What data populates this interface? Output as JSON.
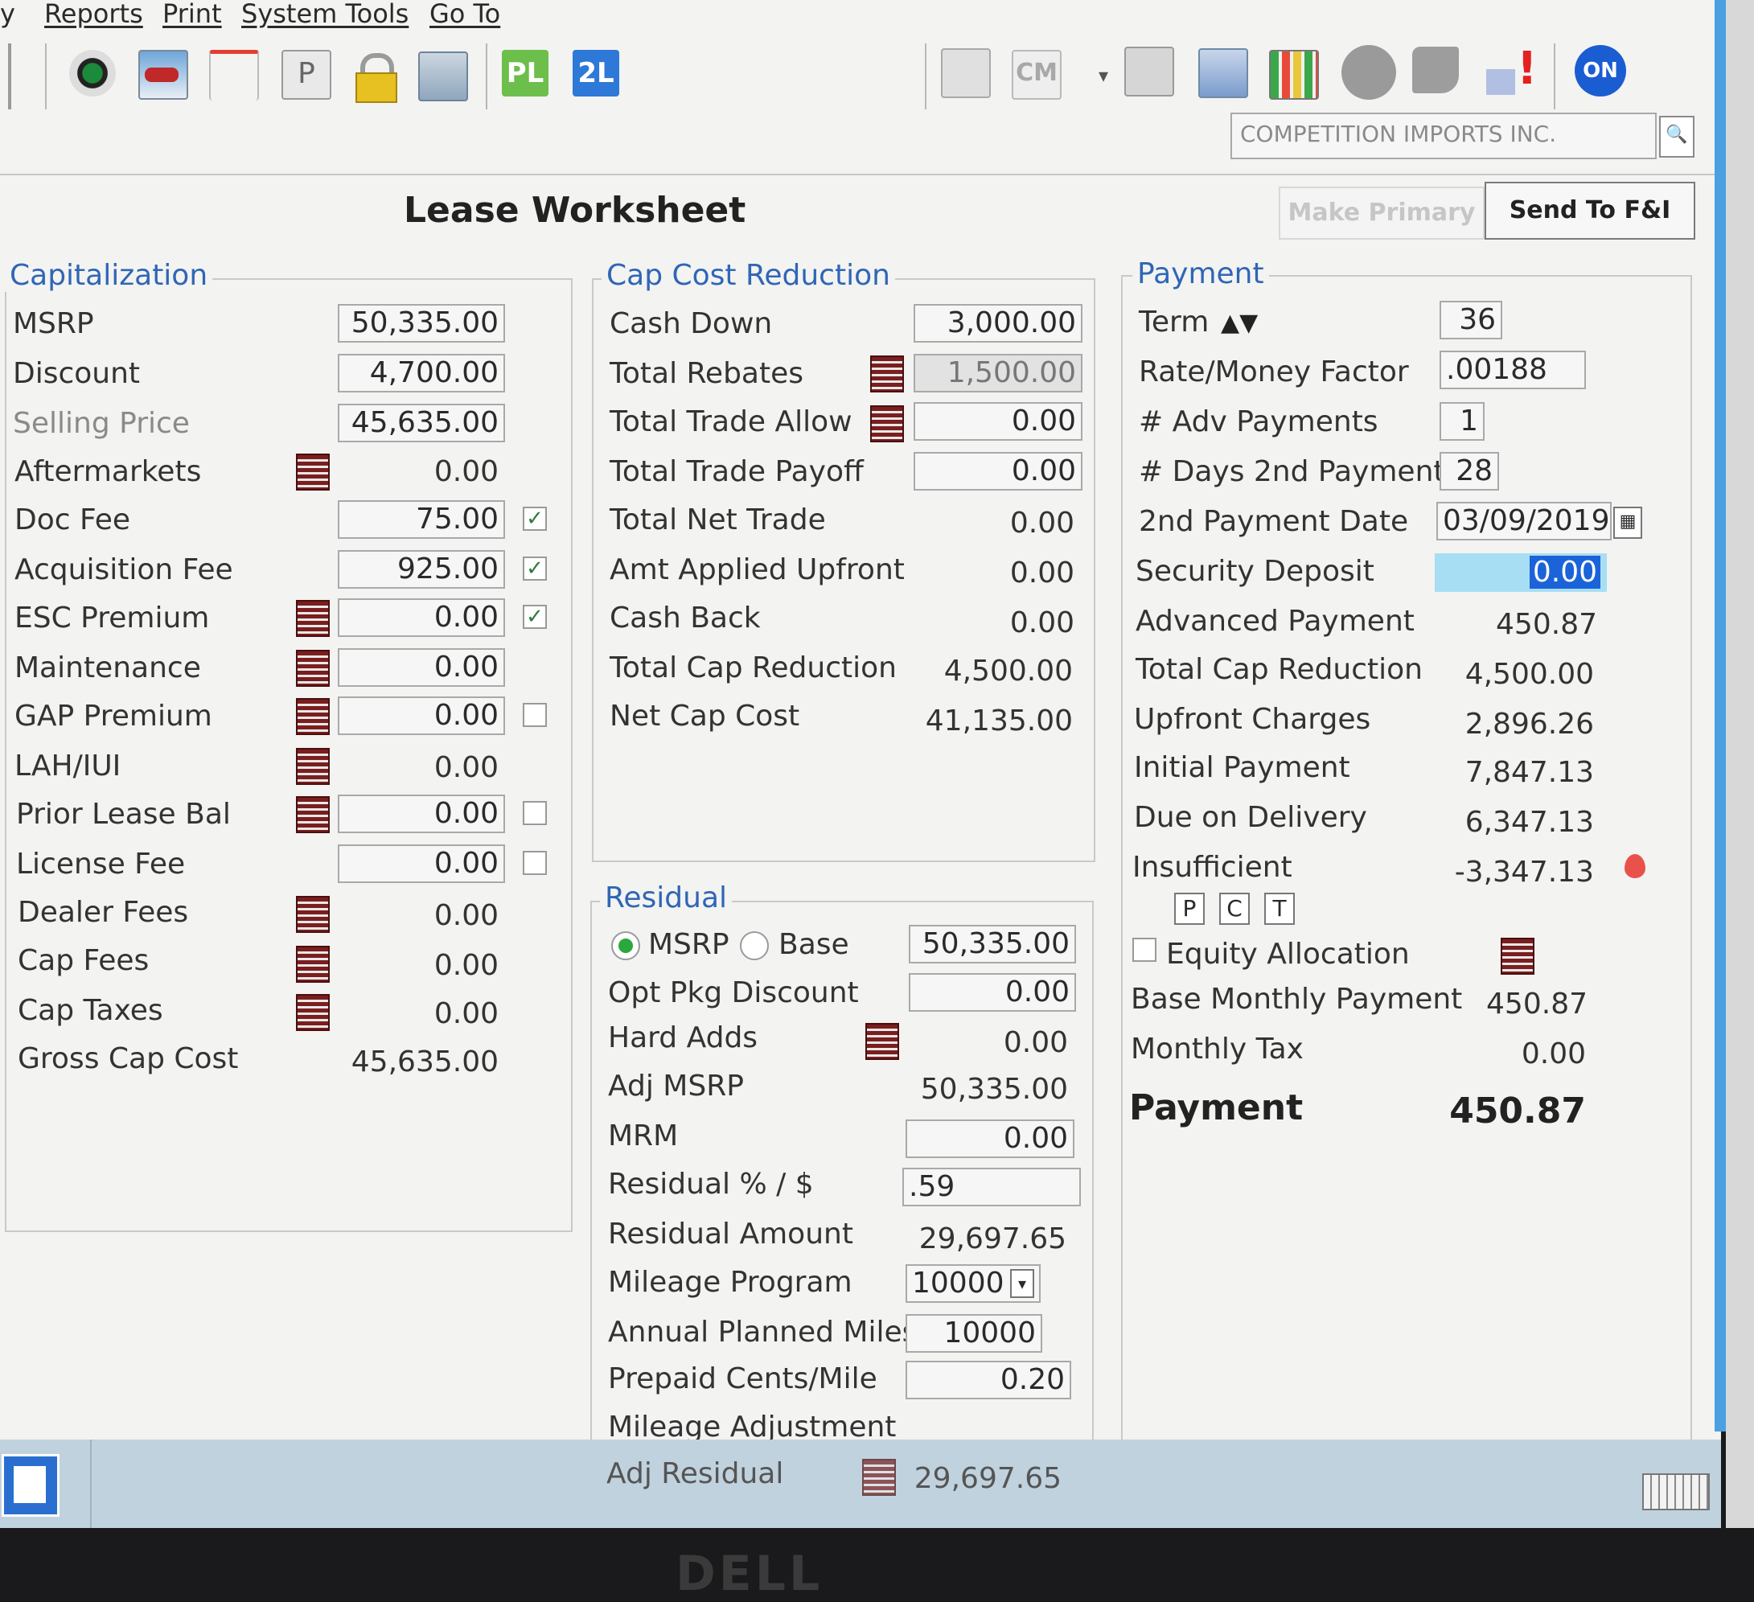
{
  "menu": {
    "item_y": "y",
    "reports": "Reports",
    "print": "Print",
    "system_tools": "System Tools",
    "go_to": "Go To"
  },
  "toolbar": {
    "pl": "PL",
    "l2": "2L",
    "cm": "CM",
    "on": "ON"
  },
  "company_search": {
    "value": "COMPETITION IMPORTS INC."
  },
  "header": {
    "title": "Lease Worksheet",
    "make_primary": "Make Primary",
    "send_fi": "Send To F&I"
  },
  "capitalization": {
    "title": "Capitalization",
    "msrp": {
      "label": "MSRP",
      "value": "50,335.00"
    },
    "discount": {
      "label": "Discount",
      "value": "4,700.00"
    },
    "selling_price": {
      "label": "Selling Price",
      "value": "45,635.00"
    },
    "aftermarkets": {
      "label": "Aftermarkets",
      "value": "0.00"
    },
    "doc_fee": {
      "label": "Doc Fee",
      "value": "75.00",
      "checked": "✓"
    },
    "acq_fee": {
      "label": "Acquisition Fee",
      "value": "925.00",
      "checked": "✓"
    },
    "esc": {
      "label": "ESC Premium",
      "value": "0.00",
      "checked": "✓"
    },
    "maintenance": {
      "label": "Maintenance",
      "value": "0.00"
    },
    "gap": {
      "label": "GAP Premium",
      "value": "0.00"
    },
    "lah": {
      "label": "LAH/IUI",
      "value": "0.00"
    },
    "prior_lease": {
      "label": "Prior Lease Bal",
      "value": "0.00"
    },
    "license_fee": {
      "label": "License Fee",
      "value": "0.00"
    },
    "dealer_fees": {
      "label": "Dealer Fees",
      "value": "0.00"
    },
    "cap_fees": {
      "label": "Cap Fees",
      "value": "0.00"
    },
    "cap_taxes": {
      "label": "Cap Taxes",
      "value": "0.00"
    },
    "gross_cap": {
      "label": "Gross Cap Cost",
      "value": "45,635.00"
    }
  },
  "cap_reduction": {
    "title": "Cap Cost Reduction",
    "cash_down": {
      "label": "Cash Down",
      "value": "3,000.00"
    },
    "rebates": {
      "label": "Total Rebates",
      "value": "1,500.00"
    },
    "trade_allow": {
      "label": "Total Trade Allow",
      "value": "0.00"
    },
    "trade_payoff": {
      "label": "Total Trade Payoff",
      "value": "0.00"
    },
    "net_trade": {
      "label": "Total Net Trade",
      "value": "0.00"
    },
    "applied_upfront": {
      "label": "Amt Applied Upfront",
      "value": "0.00"
    },
    "cash_back": {
      "label": "Cash Back",
      "value": "0.00"
    },
    "total_cap_red": {
      "label": "Total Cap Reduction",
      "value": "4,500.00"
    },
    "net_cap": {
      "label": "Net Cap Cost",
      "value": "41,135.00"
    }
  },
  "residual": {
    "title": "Residual",
    "msrp_radio": "MSRP",
    "base_radio": "Base",
    "msrp_value": "50,335.00",
    "opt_pkg": {
      "label": "Opt Pkg Discount",
      "value": "0.00"
    },
    "hard_adds": {
      "label": "Hard Adds",
      "value": "0.00"
    },
    "adj_msrp": {
      "label": "Adj MSRP",
      "value": "50,335.00"
    },
    "mrm": {
      "label": "MRM",
      "value": "0.00"
    },
    "residual_pct": {
      "label": "Residual % / $",
      "value": ".59"
    },
    "residual_amount": {
      "label": "Residual Amount",
      "value": "29,697.65"
    },
    "mileage_program": {
      "label": "Mileage Program",
      "value": "10000"
    },
    "annual_miles": {
      "label": "Annual Planned Miles",
      "value": "10000"
    },
    "prepaid_cents": {
      "label": "Prepaid Cents/Mile",
      "value": "0.20"
    },
    "mileage_adj": {
      "label": "Mileage Adjustment"
    },
    "adj_residual": {
      "label": "Adj Residual",
      "value": "29,697.65"
    }
  },
  "payment": {
    "title": "Payment",
    "term": {
      "label": "Term",
      "value": "36"
    },
    "rate": {
      "label": "Rate/Money Factor",
      "value": ".00188"
    },
    "adv_payments": {
      "label": "# Adv Payments",
      "value": "1"
    },
    "days_2nd": {
      "label": "# Days 2nd Payment",
      "value": "28"
    },
    "date_2nd": {
      "label": "2nd Payment Date",
      "value": "03/09/2019"
    },
    "security_deposit": {
      "label": "Security Deposit",
      "value": "0.00"
    },
    "advanced_payment": {
      "label": "Advanced Payment",
      "value": "450.87"
    },
    "total_cap_red": {
      "label": "Total Cap Reduction",
      "value": "4,500.00"
    },
    "upfront_charges": {
      "label": "Upfront Charges",
      "value": "2,896.26"
    },
    "initial_payment": {
      "label": "Initial Payment",
      "value": "7,847.13"
    },
    "due_on_delivery": {
      "label": "Due on Delivery",
      "value": "6,347.13"
    },
    "insufficient": {
      "label": "Insufficient",
      "value": "-3,347.13"
    },
    "p": "P",
    "c": "C",
    "t": "T",
    "equity_allocation": {
      "label": "Equity Allocation"
    },
    "base_monthly": {
      "label": "Base Monthly Payment",
      "value": "450.87"
    },
    "monthly_tax": {
      "label": "Monthly Tax",
      "value": "0.00"
    },
    "payment_total": {
      "label": "Payment",
      "value": "450.87"
    }
  },
  "footer": {
    "brand": "DELL"
  },
  "colors": {
    "accent": "#2f66b6",
    "highlight": "#a8def3",
    "selection": "#1b63d8",
    "book_icon": "#7b1e1e"
  }
}
